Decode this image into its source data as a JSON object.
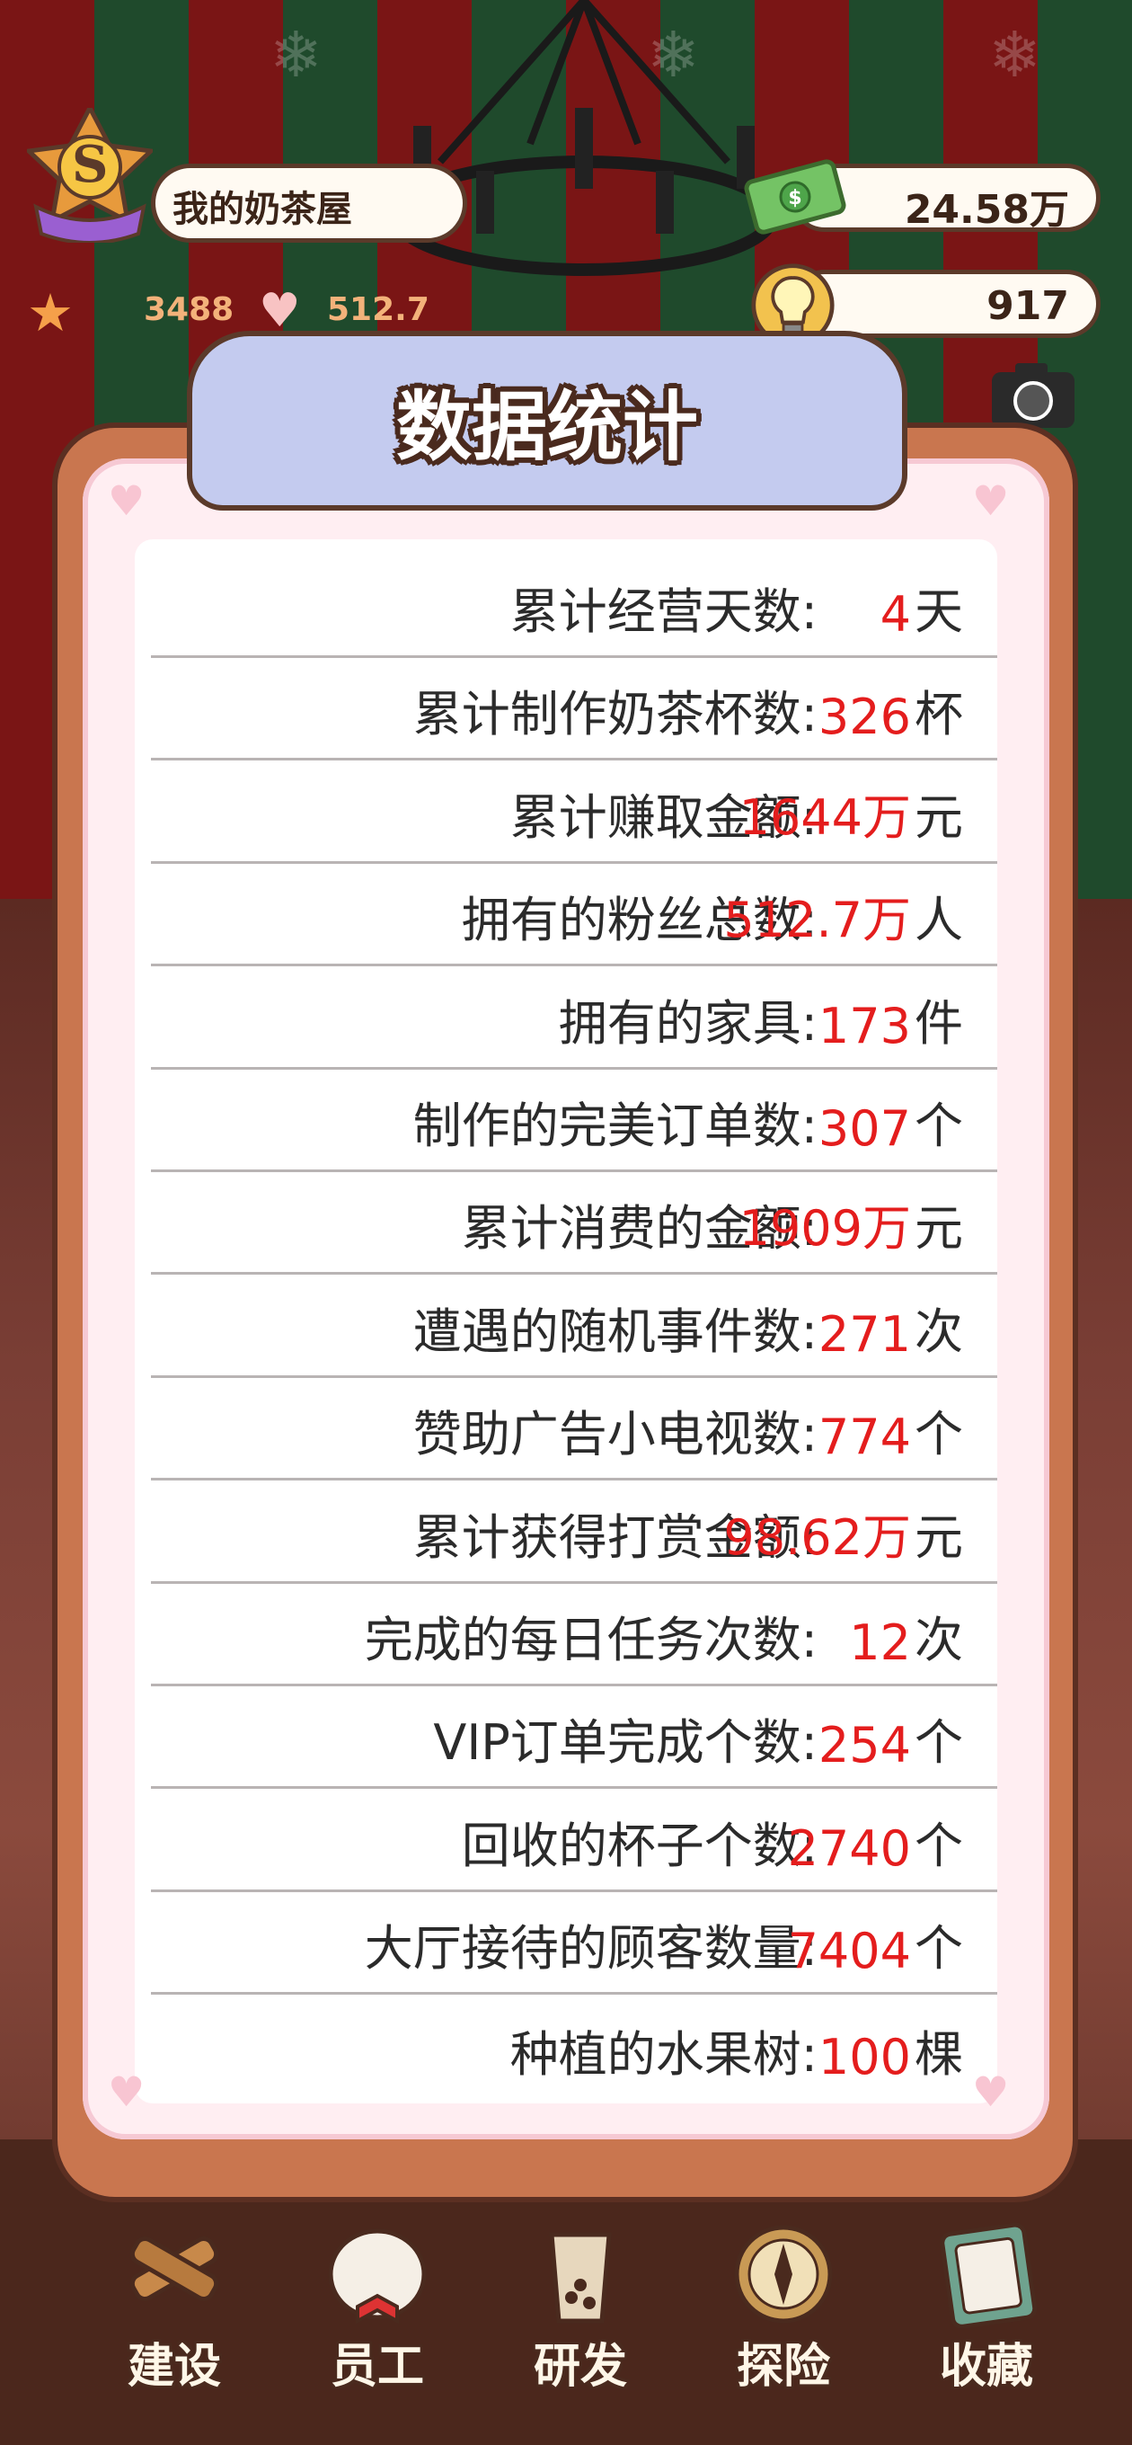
{
  "hud": {
    "rank_letter": "S",
    "shop_name": "我的奶茶屋",
    "stars": "3488",
    "fans": "512.7万",
    "money": "24.58万",
    "ideas": "917"
  },
  "panel": {
    "title": "数据统计",
    "rows": [
      {
        "label": "累计经营天数:",
        "value": "4",
        "unit": "天"
      },
      {
        "label": "累计制作奶茶杯数:",
        "value": "326",
        "unit": "杯"
      },
      {
        "label": "累计赚取金额:",
        "value": "1644万",
        "unit": "元"
      },
      {
        "label": "拥有的粉丝总数:",
        "value": "512.7万",
        "unit": "人"
      },
      {
        "label": "拥有的家具:",
        "value": "173",
        "unit": "件"
      },
      {
        "label": "制作的完美订单数:",
        "value": "307",
        "unit": "个"
      },
      {
        "label": "累计消费的金额:",
        "value": "1909万",
        "unit": "元"
      },
      {
        "label": "遭遇的随机事件数:",
        "value": "271",
        "unit": "次"
      },
      {
        "label": "赞助广告小电视数:",
        "value": "774",
        "unit": "个"
      },
      {
        "label": "累计获得打赏金额:",
        "value": "98.62万",
        "unit": "元"
      },
      {
        "label": "完成的每日任务次数:",
        "value": "12",
        "unit": "次"
      },
      {
        "label": "VIP订单完成个数:",
        "value": "254",
        "unit": "个"
      },
      {
        "label": "回收的杯子个数:",
        "value": "2740",
        "unit": "个"
      },
      {
        "label": "大厅接待的顾客数量:",
        "value": "7404",
        "unit": "个"
      },
      {
        "label": "种植的水果树:",
        "value": "100",
        "unit": "棵"
      }
    ]
  },
  "nav": [
    {
      "label": "建设",
      "icon": "hammer-icon"
    },
    {
      "label": "员工",
      "icon": "staff-icon"
    },
    {
      "label": "研发",
      "icon": "research-cup-icon"
    },
    {
      "label": "探险",
      "icon": "compass-icon"
    },
    {
      "label": "收藏",
      "icon": "collection-book-icon"
    }
  ],
  "colors": {
    "value_red": "#e41d1d",
    "panel_brown": "#c9764f",
    "tab_lavender": "#c4cbef"
  }
}
